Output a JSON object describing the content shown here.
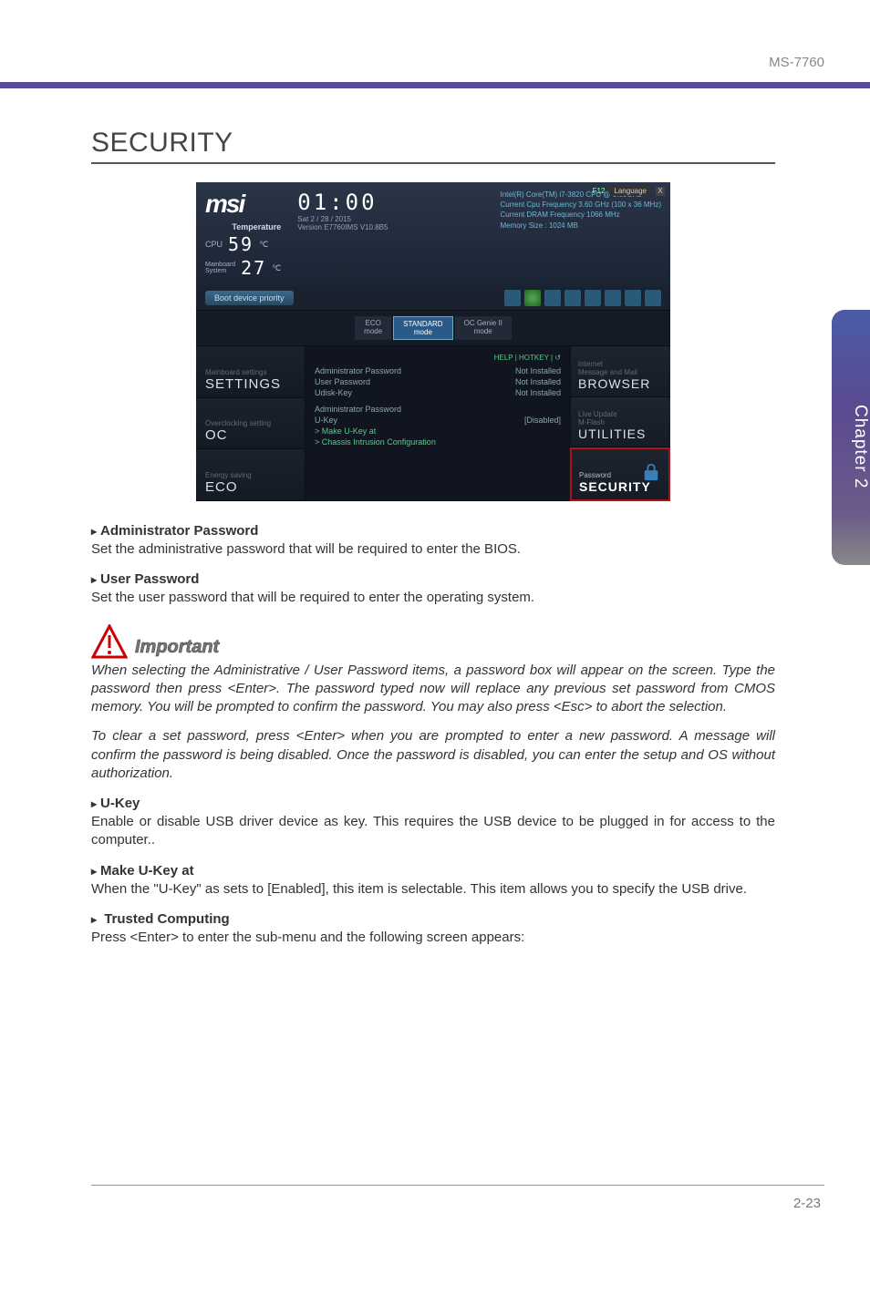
{
  "header": {
    "model": "MS-7760"
  },
  "chapter_tab": "Chapter 2",
  "section_title": "SECURITY",
  "bios": {
    "brand": "msi",
    "temperature_label": "Temperature",
    "cpu_label": "CPU",
    "cpu_temp": "59",
    "sys_label": "Mainboard\nSystem",
    "sys_temp": "27",
    "unit": "℃",
    "clock": {
      "time": "01:00",
      "date": "Sat  2 / 28 / 2015",
      "ver": "Version E7760IMS V10.8B5"
    },
    "info": {
      "l1": "Intel(R) Core(TM) i7-3820 CPU @ 3.60GHz",
      "l2": "Current Cpu Frequency 3.60 GHz (100 x 36 MHz)",
      "l3": "Current DRAM Frequency 1066 MHz",
      "l4": "Memory Size : 1024 MB"
    },
    "lang_f12": "F12",
    "lang": "Language",
    "boot_priority": "Boot device priority",
    "modes": {
      "eco": "ECO\nmode",
      "std": "STANDARD\nmode",
      "ocg": "OC Genie II\nmode"
    },
    "left_nav": {
      "settings": {
        "sub": "Mainboard settings",
        "lab": "SETTINGS"
      },
      "oc": {
        "sub": "Overclocking setting",
        "lab": "OC"
      },
      "eco": {
        "sub": "Energy saving",
        "lab": "ECO"
      }
    },
    "center": {
      "help": "HELP | HOTKEY | ↺",
      "items": [
        {
          "k": "Administrator Password",
          "v": "Not Installed"
        },
        {
          "k": "User Password",
          "v": "Not Installed"
        },
        {
          "k": "Udisk-Key",
          "v": "Not Installed"
        },
        {
          "k": "",
          "v": ""
        },
        {
          "k": "Administrator Password",
          "v": ""
        },
        {
          "k": "U-Key",
          "v": "[Disabled]"
        }
      ],
      "green1": "> Make U-Key at",
      "green2": "> Chassis Intrusion Configuration"
    },
    "right_nav": {
      "browser": {
        "sub": "Internet\nMessage and Mail",
        "lab": "BROWSER"
      },
      "util": {
        "sub": "Live Update\nM-Flash",
        "lab": "UTILITIES"
      },
      "security": {
        "sub": "Password",
        "lab": "SECURITY"
      }
    }
  },
  "body": {
    "admin_pw_h": "Administrator Password",
    "admin_pw_p": "Set the administrative password that will be required to enter the BIOS.",
    "user_pw_h": "User Password",
    "user_pw_p": "Set the user password that will be required to enter the operating system.",
    "important_label": "Important",
    "imp_p1": "When selecting the Administrative / User Password items, a password box will appear on the screen. Type the password then press <Enter>. The password typed now will replace any previous set password from CMOS memory. You will be prompted to confirm the password. You may also press <Esc> to abort the selection.",
    "imp_p2": "To clear a set password, press <Enter> when you are prompted to enter a new password. A message will confirm the password is being disabled. Once the password is disabled, you can enter the setup and OS without authorization.",
    "ukey_h": "U-Key",
    "ukey_p": "Enable or disable USB driver device as key. This requires the USB device to be plugged in for access to the computer..",
    "makeukey_h": "Make U-Key at",
    "makeukey_p": "When the \"U-Key\" as sets to [Enabled], this item is selectable. This item allows you to specify the USB drive.",
    "trusted_h": " Trusted Computing",
    "trusted_p": "Press <Enter> to enter the sub-menu and the following screen appears:"
  },
  "footer": {
    "page": "2-23"
  }
}
